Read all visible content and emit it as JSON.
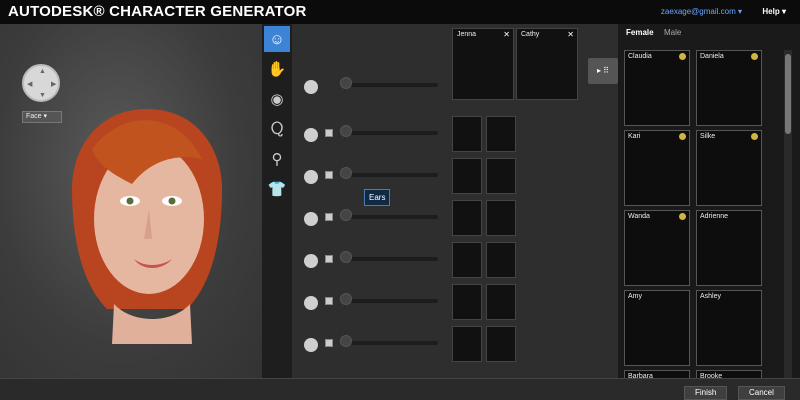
{
  "header": {
    "title": "AUTODESK® CHARACTER GENERATOR",
    "account": "zaexage@gmail.com",
    "help": "Help"
  },
  "viewport": {
    "region_select": "Face"
  },
  "tools": [
    {
      "icon": "face-icon",
      "active": true
    },
    {
      "icon": "hand-icon",
      "active": false
    },
    {
      "icon": "eye-icon",
      "active": false
    },
    {
      "icon": "hair-icon",
      "active": false
    },
    {
      "icon": "body-icon",
      "active": false
    },
    {
      "icon": "clothing-icon",
      "active": false
    }
  ],
  "blend_sources": [
    {
      "name": "Jenna"
    },
    {
      "name": "Cathy"
    }
  ],
  "slider_rows": [
    {
      "icon": "head-icon",
      "level": 0.0
    },
    {
      "icon": "mask-icon",
      "level": 0.0
    },
    {
      "icon": "mask-icon",
      "level": 0.0
    },
    {
      "icon": "mask-icon",
      "level": 0.0
    },
    {
      "icon": "mask-icon",
      "level": 0.0
    },
    {
      "icon": "mask-icon",
      "level": 0.0
    }
  ],
  "tooltip": "Ears",
  "presets": {
    "tab_female": "Female",
    "tab_male": "Male",
    "items": [
      {
        "name": "Claudia",
        "warn": true
      },
      {
        "name": "Daniela",
        "warn": true
      },
      {
        "name": "Kari",
        "warn": true
      },
      {
        "name": "Silke",
        "warn": true
      },
      {
        "name": "Wanda",
        "warn": true
      },
      {
        "name": "Adrienne",
        "warn": false
      },
      {
        "name": "Amy",
        "warn": false
      },
      {
        "name": "Ashley",
        "warn": false
      },
      {
        "name": "Barbara",
        "warn": false
      },
      {
        "name": "Brooke",
        "warn": false
      }
    ]
  },
  "footer": {
    "finish": "Finish",
    "cancel": "Cancel"
  },
  "colors": {
    "accent": "#3d84d6",
    "hair": "#b8451f",
    "skin": "#e6b7a0"
  }
}
